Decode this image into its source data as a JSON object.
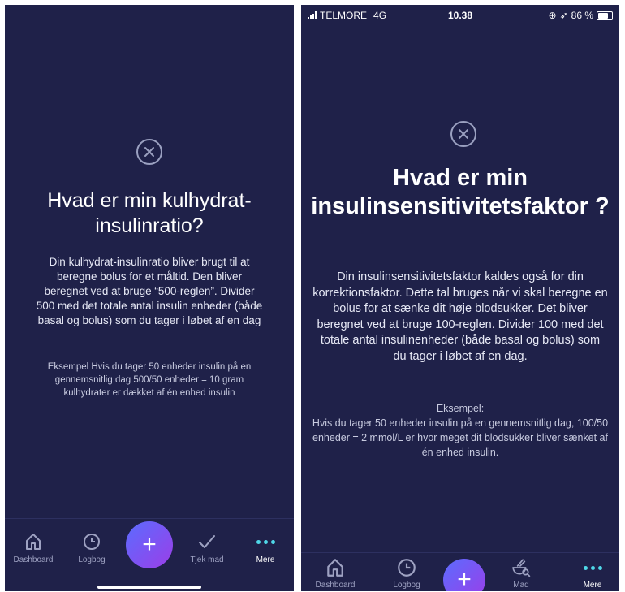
{
  "screen1": {
    "title": "Hvad er min kulhydrat-insulinratio?",
    "body": "Din kulhydrat-insulinratio bliver brugt til at beregne bolus for et måltid. Den bliver beregnet ved at bruge “500-reglen”. Divider 500 med det totale antal insulin enheder (både basal og bolus) som du tager i løbet af en dag",
    "example": "Eksempel Hvis du tager 50 enheder insulin på en gennemsnitlig dag 500/50 enheder = 10 gram kulhydrater er dækket af én enhed insulin",
    "tabs": [
      "Dashboard",
      "Logbog",
      "Tjek mad",
      "Mere"
    ],
    "fab_label": "+"
  },
  "screen2": {
    "status": {
      "carrier": "TELMORE",
      "network": "4G",
      "time": "10.38",
      "battery": "86 %",
      "battery_level": 0.86
    },
    "title": "Hvad er min insulinsensitivitetsfaktor ?",
    "body": "Din insulinsensitivitetsfaktor kaldes også for din korrektionsfaktor. Dette tal bruges når vi skal beregne en bolus for at sænke dit høje blodsukker. Det bliver beregnet ved at bruge 100-reglen. Divider 100 med det totale antal insulinenheder (både basal og bolus) som du tager i løbet af en dag.",
    "example_heading": "Eksempel:",
    "example": "Hvis du tager 50 enheder insulin på en gennemsnitlig dag, 100/50 enheder = 2 mmol/L er hvor meget dit blodsukker bliver sænket af én enhed insulin.",
    "tabs": [
      "Dashboard",
      "Logbog",
      "Mad",
      "Mere"
    ],
    "fab_label": "+"
  },
  "colors": {
    "background": "#1f2149",
    "accent": "#4fd8e8",
    "fab_start": "#5b6cff",
    "fab_end": "#9b3ee8"
  }
}
